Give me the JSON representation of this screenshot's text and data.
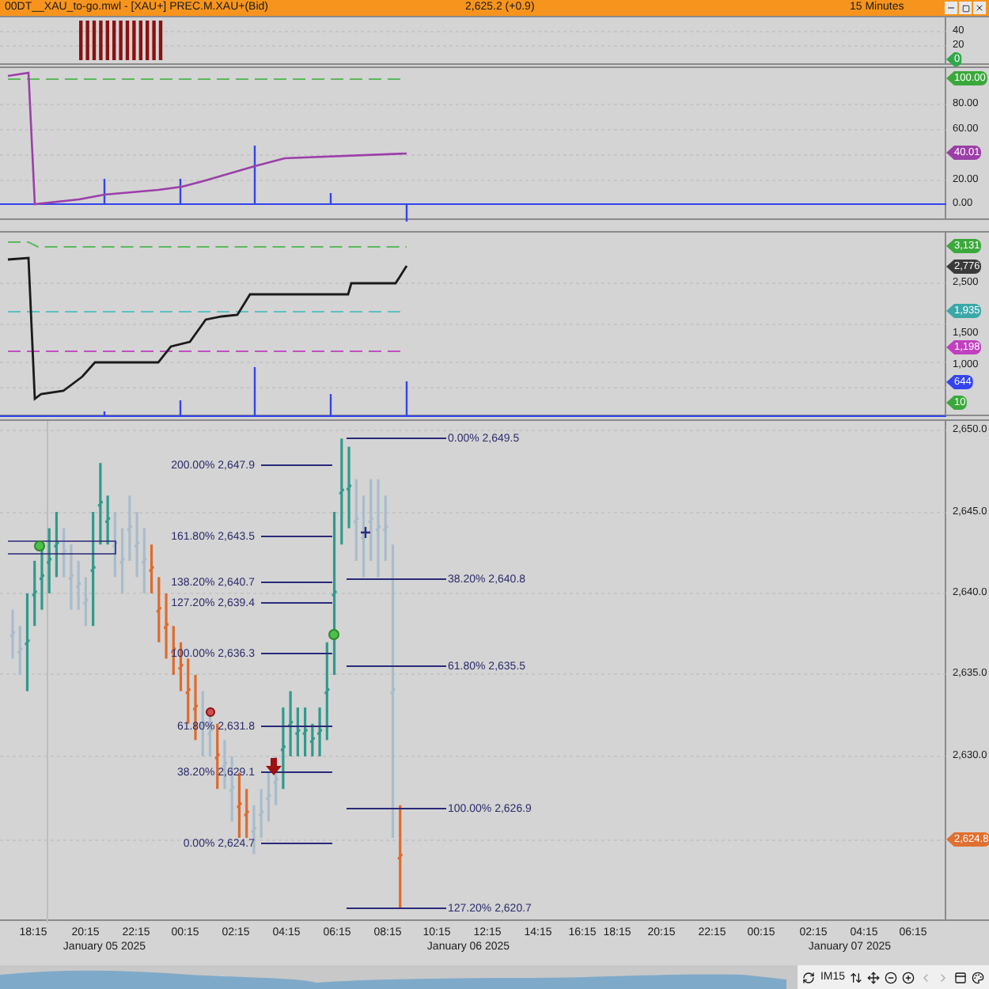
{
  "title_bar": {
    "title": "00DT__XAU_to-go.mwl - [XAU+] PREC.M.XAU+(Bid)",
    "quote": "2,625.2 (+0.9)",
    "interval": "15 Minutes"
  },
  "panels": [
    {
      "kind": "histogram",
      "ticks": [
        "40",
        "20"
      ],
      "markers": [
        {
          "text": "0",
          "color": "#2fa84a"
        }
      ]
    },
    {
      "kind": "oscillator",
      "ticks": [
        "80.00",
        "60.00",
        "20.00",
        "0.00"
      ],
      "markers": [
        {
          "text": "100.00",
          "color": "#3aa83a"
        },
        {
          "text": "40.01",
          "color": "#9b3fa8"
        }
      ]
    },
    {
      "kind": "steps",
      "ticks": [
        "2,500",
        "1,500",
        "1,000"
      ],
      "markers": [
        {
          "text": "3,131",
          "color": "#3aa83a"
        },
        {
          "text": "2,776",
          "color": "#3a3a3a"
        },
        {
          "text": "1,935",
          "color": "#3aa8a8"
        },
        {
          "text": "1,198",
          "color": "#c040c0"
        },
        {
          "text": "644",
          "color": "#3344ee"
        },
        {
          "text": "10",
          "color": "#3aa83a"
        }
      ]
    },
    {
      "kind": "price",
      "ticks": [
        "2,650.0",
        "2,645.0",
        "2,640.0",
        "2,635.0",
        "2,630.0"
      ],
      "markers": [
        {
          "text": "2,624.8",
          "color": "#e07030"
        }
      ],
      "fib_left": [
        "200.00% 2,647.9",
        "161.80% 2,643.5",
        "138.20% 2,640.7",
        "127.20% 2,639.4",
        "100.00% 2,636.3",
        "61.80% 2,631.8",
        "38.20% 2,629.1",
        "0.00% 2,624.7"
      ],
      "fib_right": [
        "0.00% 2,649.5",
        "38.20% 2,640.8",
        "61.80% 2,635.5",
        "100.00% 2,626.9",
        "127.20% 2,620.7"
      ]
    }
  ],
  "time_axis": [
    "18:15",
    "20:15",
    "22:15",
    "00:15",
    "02:15",
    "04:15",
    "06:15",
    "08:15",
    "10:15",
    "12:15",
    "14:15",
    "16:15",
    "18:15",
    "20:15",
    "22:15",
    "00:15",
    "02:15",
    "04:15",
    "06:15"
  ],
  "dates": [
    "January 05 2025",
    "January 06 2025",
    "January 07 2025"
  ],
  "toolbar": {
    "interval": "IM15"
  }
}
